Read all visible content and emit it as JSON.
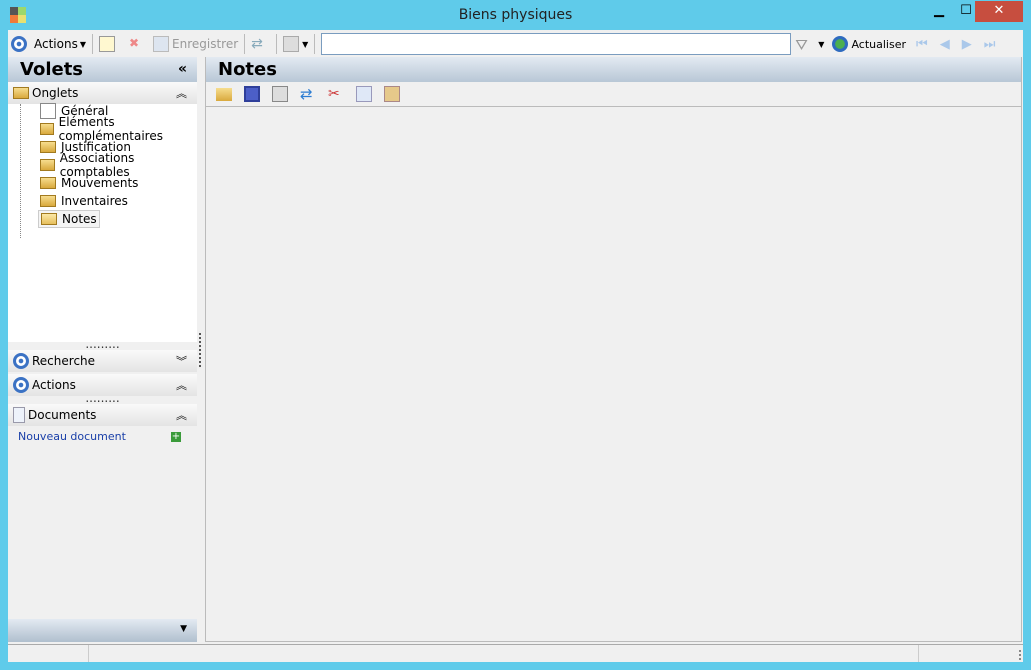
{
  "window": {
    "title": "Biens physiques",
    "minimize": "▁",
    "maximize": "☐",
    "close": "✕"
  },
  "toolbar": {
    "actions": "Actions",
    "save": "Enregistrer",
    "refresh": "Actualiser",
    "search_value": ""
  },
  "left": {
    "title": "Volets",
    "collapse": "«",
    "onglets": {
      "label": "Onglets",
      "items": [
        "Général",
        "Eléments complémentaires",
        "Justification",
        "Associations comptables",
        "Mouvements",
        "Inventaires",
        "Notes"
      ],
      "selected": "Notes"
    },
    "recherche": "Recherche",
    "actions": "Actions",
    "documents": "Documents",
    "new_document": "Nouveau document"
  },
  "main": {
    "title": "Notes"
  }
}
